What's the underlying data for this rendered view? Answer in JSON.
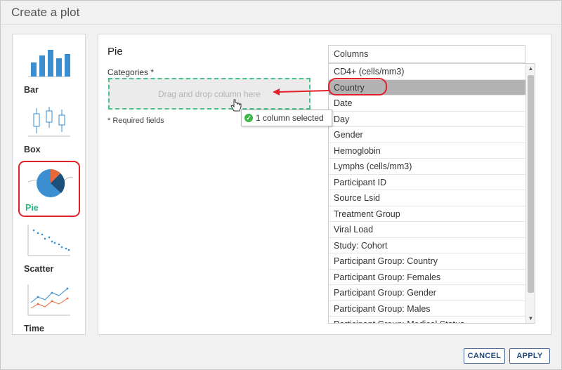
{
  "dialog": {
    "title": "Create a plot"
  },
  "chart_types": [
    {
      "label": "Bar",
      "icon": "bar-chart-icon"
    },
    {
      "label": "Box",
      "icon": "box-plot-icon"
    },
    {
      "label": "Pie",
      "icon": "pie-chart-icon",
      "selected": true
    },
    {
      "label": "Scatter",
      "icon": "scatter-plot-icon"
    },
    {
      "label": "Time",
      "icon": "time-chart-icon"
    }
  ],
  "main": {
    "heading": "Pie",
    "categories_label": "Categories *",
    "dropzone_text": "Drag and drop column here",
    "required_note": "* Required fields"
  },
  "columns": {
    "header": "Columns",
    "items": [
      "CD4+ (cells/mm3)",
      "Country",
      "Date",
      "Day",
      "Gender",
      "Hemoglobin",
      "Lymphs (cells/mm3)",
      "Participant ID",
      "Source Lsid",
      "Treatment Group",
      "Viral Load",
      "Study: Cohort",
      "Participant Group: Country",
      "Participant Group: Females",
      "Participant Group: Gender",
      "Participant Group: Males",
      "Participant Group: Medical Status"
    ],
    "highlighted": "Country"
  },
  "drag_tooltip": {
    "text": "1 column selected",
    "icon": "check-circle-icon"
  },
  "buttons": {
    "cancel": "CANCEL",
    "apply": "APPLY"
  },
  "colors": {
    "accent_green": "#2eb67d",
    "annotation_red": "#e0212c",
    "button_blue": "#22497a",
    "pie_blue": "#3b8fd0",
    "pie_orange": "#e8683a",
    "pie_navy": "#1c4f7a"
  }
}
